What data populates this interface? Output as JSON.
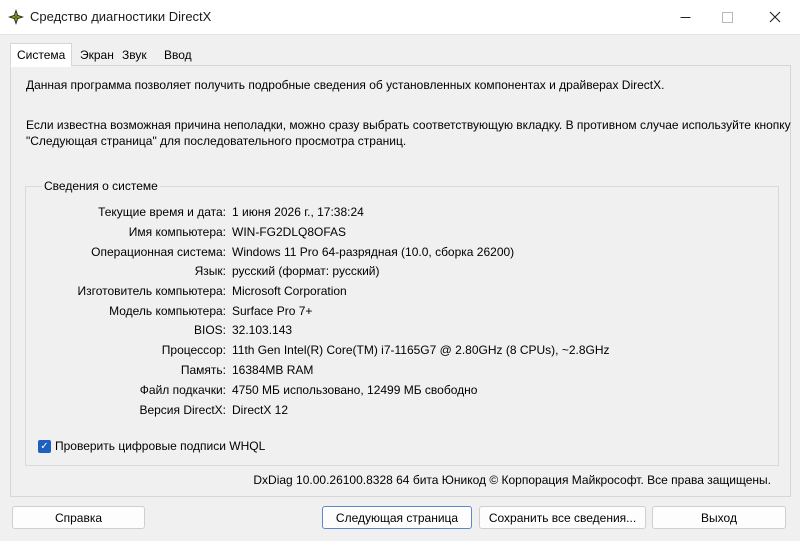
{
  "window": {
    "title": "Средство диагностики DirectX",
    "controls": {
      "minimize_icon": "minimize-icon",
      "maximize_icon": "maximize-icon",
      "close_icon": "close-icon"
    }
  },
  "tabs": [
    {
      "label": "Система",
      "active": true
    },
    {
      "label": "Экран"
    },
    {
      "label": "Звук"
    },
    {
      "label": "Ввод"
    }
  ],
  "intro": {
    "line1": "Данная программа позволяет получить подробные сведения об установленных компонентах и драйверах DirectX.",
    "line2": "Если известна возможная причина неполадки, можно сразу выбрать соответствующую вкладку. В противном случае используйте кнопку",
    "line3": "\"Следующая страница\" для последовательного просмотра страниц."
  },
  "system_info": {
    "title": "Сведения о системе",
    "rows": [
      {
        "label": "Текущие время и дата:",
        "value": "1 июня 2026 г., 17:38:24"
      },
      {
        "label": "Имя компьютера:",
        "value": "WIN-FG2DLQ8OFAS"
      },
      {
        "label": "Операционная система:",
        "value": "Windows 11 Pro 64-разрядная (10.0, сборка 26200)"
      },
      {
        "label": "Язык:",
        "value": "русский (формат: русский)"
      },
      {
        "label": "Изготовитель компьютера:",
        "value": "Microsoft Corporation"
      },
      {
        "label": "Модель компьютера:",
        "value": "Surface Pro 7+"
      },
      {
        "label": "BIOS:",
        "value": "32.103.143"
      },
      {
        "label": "Процессор:",
        "value": "11th Gen Intel(R) Core(TM) i7-1165G7 @ 2.80GHz (8 CPUs), ~2.8GHz"
      },
      {
        "label": "Память:",
        "value": "16384MB RAM"
      },
      {
        "label": "Файл подкачки:",
        "value": "4750 МБ использовано, 12499 МБ свободно"
      },
      {
        "label": "Версия DirectX:",
        "value": "DirectX 12"
      }
    ]
  },
  "whql_checkbox": {
    "label": "Проверить цифровые подписи WHQL",
    "checked": true,
    "check_glyph": "✓"
  },
  "footer": "DxDiag 10.00.26100.8328 64 бита Юникод © Корпорация Майкрософт. Все права защищены.",
  "buttons": {
    "help": "Справка",
    "next": "Следующая страница",
    "save": "Сохранить все сведения...",
    "exit": "Выход"
  },
  "colors": {
    "accent": "#1f5fbf",
    "window_bg": "#f0f0f0",
    "titlebar_bg": "#ffffff"
  }
}
